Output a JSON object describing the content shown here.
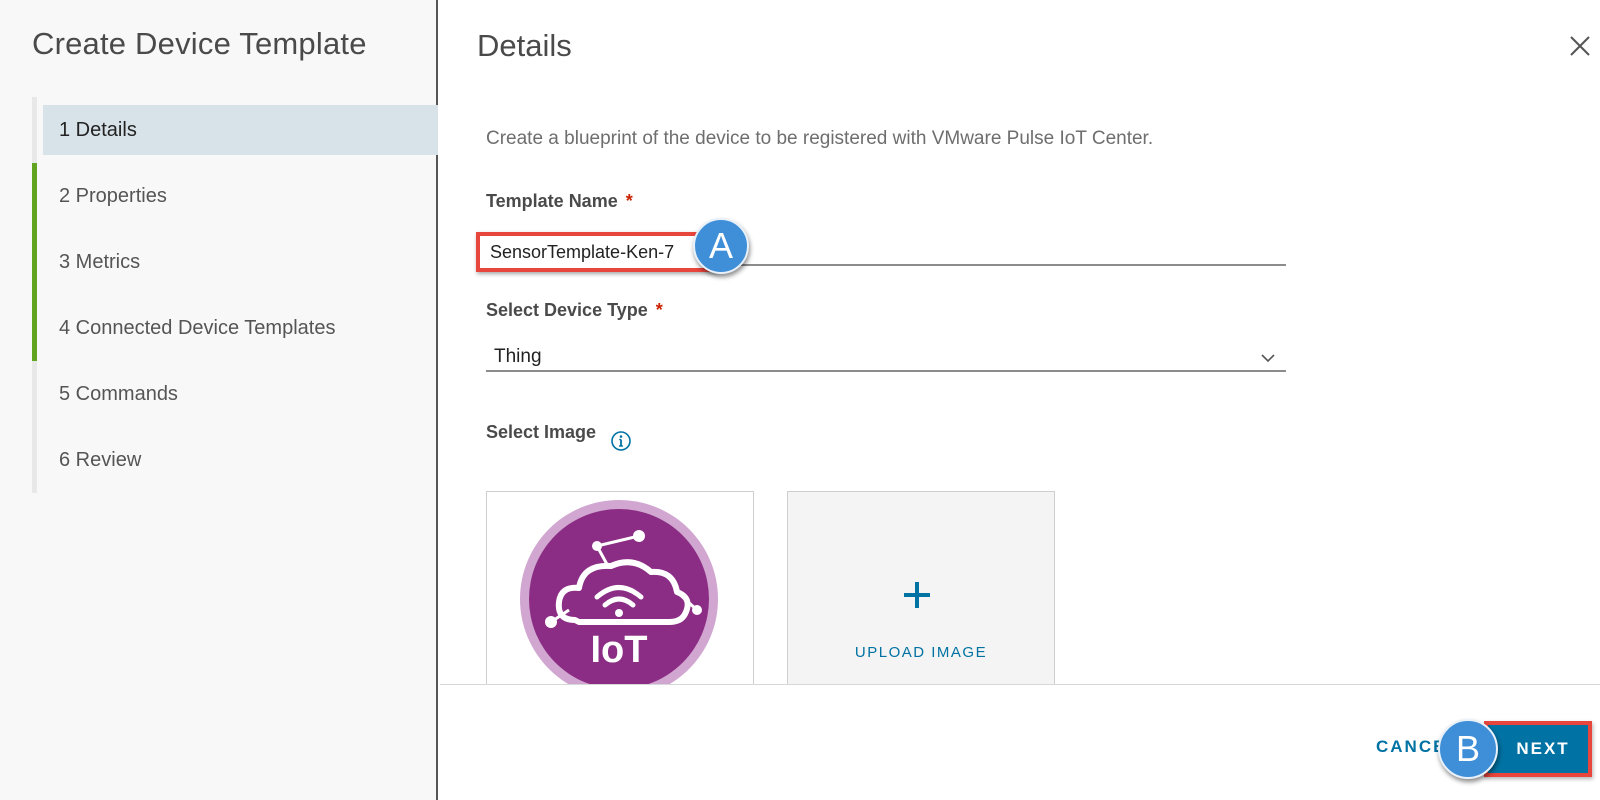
{
  "wizard": {
    "title": "Create Device Template",
    "steps": [
      {
        "label": "1  Details",
        "state": "active"
      },
      {
        "label": "2  Properties",
        "state": "done"
      },
      {
        "label": "3  Metrics",
        "state": "done"
      },
      {
        "label": "4  Connected Device Templates",
        "state": "done"
      },
      {
        "label": "5  Commands",
        "state": "pending"
      },
      {
        "label": "6  Review",
        "state": "pending"
      }
    ]
  },
  "main": {
    "title": "Details",
    "description": "Create a blueprint of the device to be registered with VMware Pulse IoT Center.",
    "template_name": {
      "label": "Template Name",
      "required_mark": "*",
      "value": "SensorTemplate-Ken-7"
    },
    "device_type": {
      "label": "Select Device Type",
      "required_mark": "*",
      "selected": "Thing"
    },
    "image": {
      "label": "Select Image",
      "iot_text": "IoT",
      "upload_label": "UPLOAD IMAGE"
    }
  },
  "callouts": {
    "a": "A",
    "b": "B"
  },
  "footer": {
    "cancel_label": "CANCEL",
    "next_label": "NEXT"
  },
  "colors": {
    "accent_blue": "#0072a3",
    "progress_green": "#62a420",
    "highlight_red": "#e8453c",
    "callout_blue": "#3e8ed8",
    "iot_purple": "#8b2d84"
  }
}
